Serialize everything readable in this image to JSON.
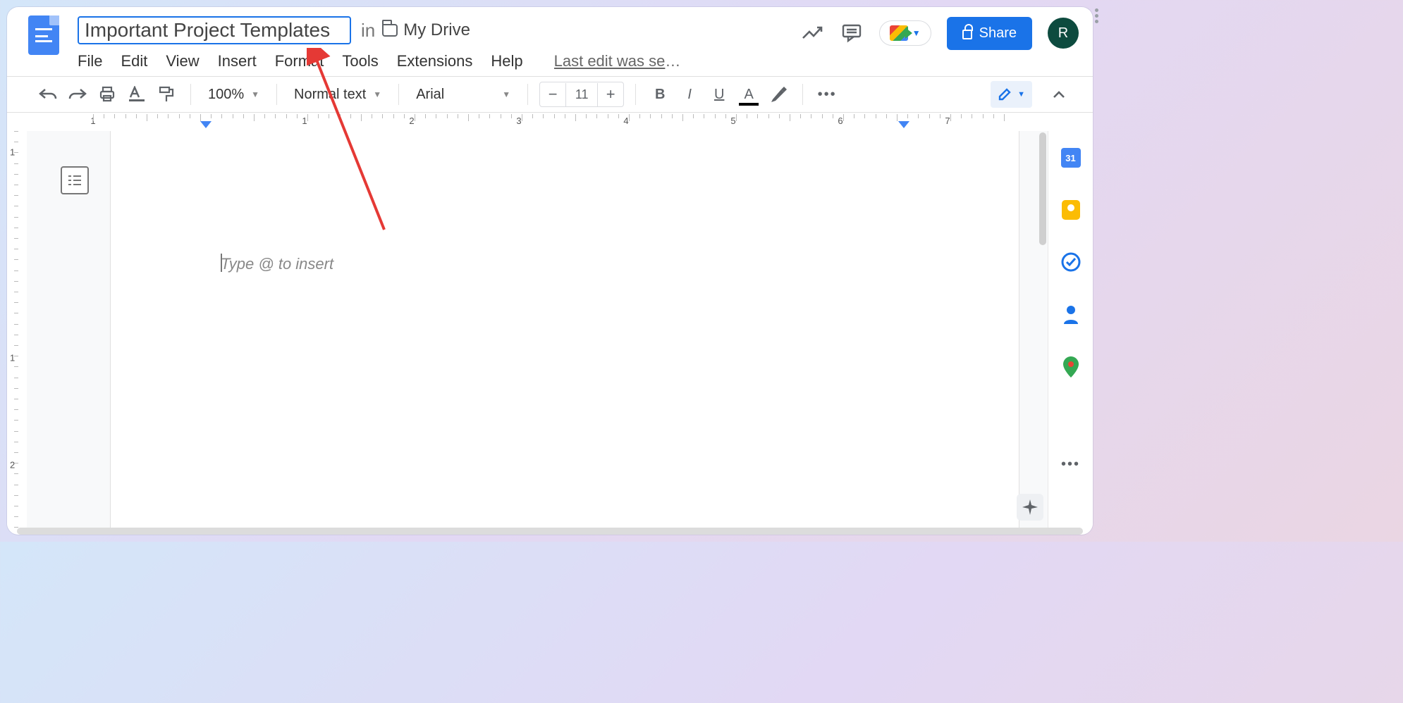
{
  "title": {
    "doc_name": "Important Project Templates",
    "in_label": "in",
    "location": "My Drive"
  },
  "lastEdit": "Last edit was sec…",
  "share": "Share",
  "avatar": "R",
  "menus": [
    "File",
    "Edit",
    "View",
    "Insert",
    "Format",
    "Tools",
    "Extensions",
    "Help"
  ],
  "toolbar": {
    "zoom": "100%",
    "style": "Normal text",
    "font": "Arial",
    "fontSize": "11"
  },
  "document": {
    "placeholder": "Type @ to insert"
  },
  "ruler": {
    "nums": [
      "1",
      "1",
      "2",
      "3",
      "4",
      "5",
      "6",
      "7"
    ]
  },
  "vruler": {
    "nums": [
      "1",
      "1",
      "2"
    ]
  },
  "sidepanel": {
    "calendar_day": "31"
  }
}
